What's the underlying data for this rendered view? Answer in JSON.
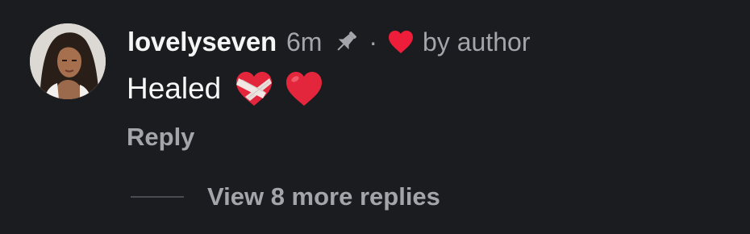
{
  "comment": {
    "avatar_icon": "profile-photo-avatar",
    "username": "lovelyseven",
    "time_ago": "6m",
    "pin_icon": "pin-icon",
    "separator": "·",
    "liked_icon": "red-heart-icon",
    "liked_by_label": "by author",
    "text": "Healed",
    "emojis": [
      "mending-heart-emoji",
      "red-heart-emoji"
    ],
    "reply_label": "Reply",
    "view_more_label": "View 8 more replies"
  },
  "colors": {
    "background": "#1a1c1f",
    "primary_text": "#f5f5f5",
    "secondary_text": "#a3a5aa",
    "heart_red": "#ee1d3a",
    "divider": "#4a4c51"
  }
}
